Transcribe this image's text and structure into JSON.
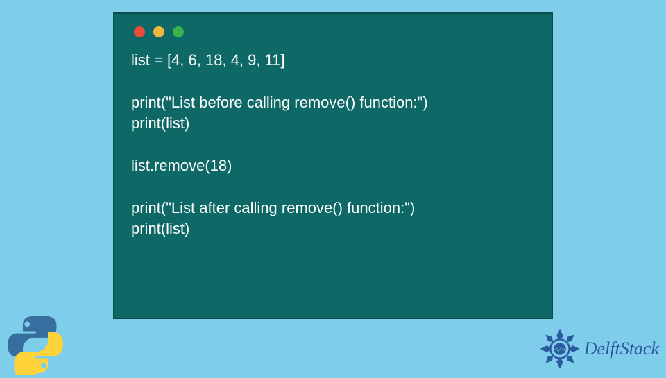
{
  "code": {
    "lines": [
      "list = [4, 6, 18, 4, 9, 11]",
      "",
      "print(\"List before calling remove() function:\")",
      "print(list)",
      "",
      "list.remove(18)",
      "",
      "print(\"List after calling remove() function:\")",
      "print(list)"
    ]
  },
  "brand": {
    "name": "DelftStack"
  },
  "colors": {
    "page_bg": "#7ecdea",
    "window_bg": "#0d6866",
    "window_border": "#0a4c4a",
    "code_text": "#ffffff",
    "dot_red": "#e94b3c",
    "dot_yellow": "#f2b63c",
    "dot_green": "#3bb24a",
    "brand_color": "#2b5a9e"
  },
  "icons": {
    "python": "python-logo",
    "brand": "delftstack-mandala"
  }
}
